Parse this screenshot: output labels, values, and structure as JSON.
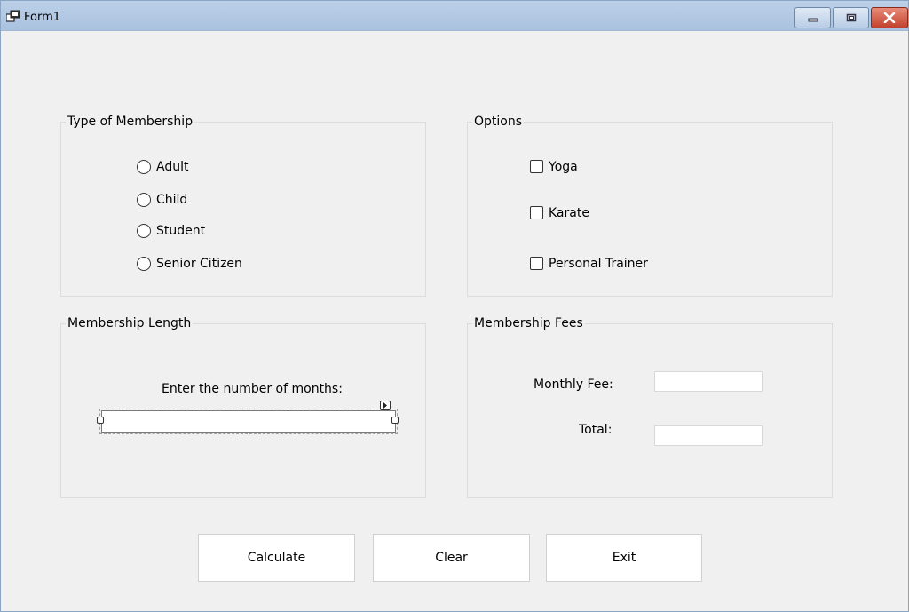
{
  "window": {
    "title": "Form1"
  },
  "membership_type": {
    "legend": "Type of Membership",
    "options": [
      "Adult",
      "Child",
      "Student",
      "Senior Citizen"
    ]
  },
  "options": {
    "legend": "Options",
    "items": [
      "Yoga",
      "Karate",
      "Personal Trainer"
    ]
  },
  "membership_length": {
    "legend": "Membership Length",
    "prompt": "Enter the number of months:",
    "months_value": ""
  },
  "membership_fees": {
    "legend": "Membership Fees",
    "monthly_fee_label": "Monthly Fee:",
    "monthly_fee_value": "",
    "total_label": "Total:",
    "total_value": ""
  },
  "buttons": {
    "calculate": "Calculate",
    "clear": "Clear",
    "exit": "Exit"
  },
  "colors": {
    "close_button": "#c2412c",
    "titlebar": "#aac2df",
    "form_background": "#f0f0f0"
  }
}
